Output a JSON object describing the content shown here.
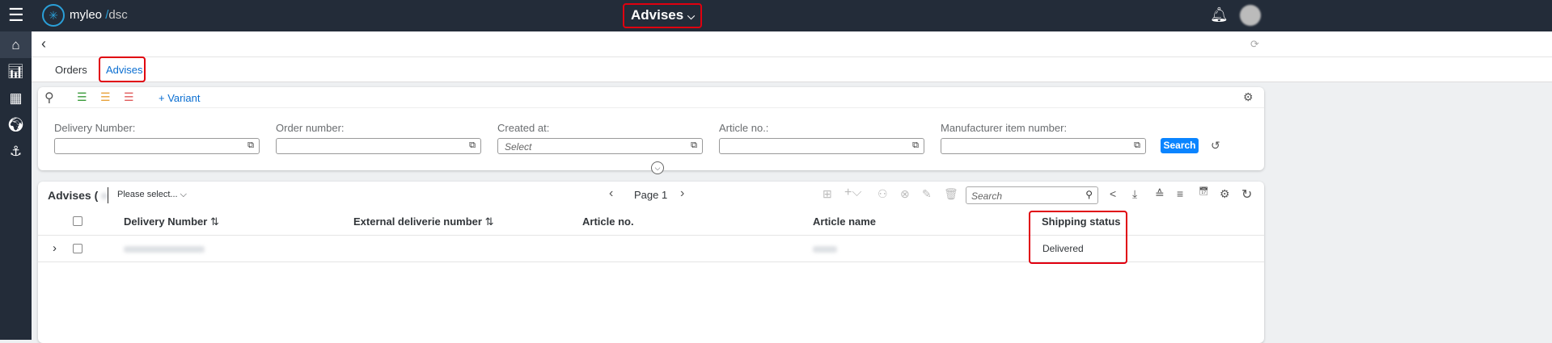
{
  "header": {
    "logo_brand": "myleo",
    "logo_sep": "/",
    "logo_product": "dsc",
    "title": "Advises"
  },
  "tabs": [
    {
      "label": "Orders"
    },
    {
      "label": "Advises"
    }
  ],
  "filter": {
    "variant_label": "+ Variant",
    "fields": [
      {
        "label": "Delivery Number:",
        "value": "",
        "placeholder": ""
      },
      {
        "label": "Order number:",
        "value": "",
        "placeholder": ""
      },
      {
        "label": "Created at:",
        "value": "",
        "placeholder": "Select"
      },
      {
        "label": "Article no.:",
        "value": "",
        "placeholder": ""
      },
      {
        "label": "Manufacturer item number:",
        "value": "",
        "placeholder": ""
      }
    ],
    "search_label": "Search"
  },
  "table": {
    "title": "Advises (",
    "select_placeholder": "Please select...",
    "page_label": "Page 1",
    "search_placeholder": "Search",
    "columns": [
      "Delivery Number",
      "External deliverie number",
      "Article no.",
      "Article name",
      "Shipping status"
    ],
    "rows": [
      {
        "delivery_number": "",
        "external": "",
        "article_no": "",
        "article_name": "",
        "shipping_status": "Delivered"
      }
    ]
  }
}
